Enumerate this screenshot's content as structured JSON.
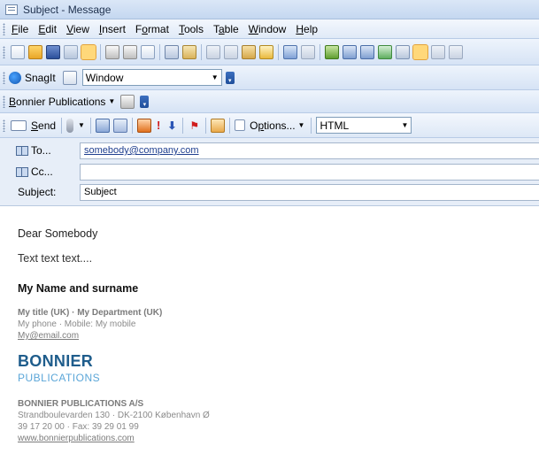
{
  "window": {
    "title": "Subject - Message"
  },
  "menu": [
    {
      "label": "File",
      "accel": "F",
      "rest": "ile"
    },
    {
      "label": "Edit",
      "accel": "E",
      "rest": "dit"
    },
    {
      "label": "View",
      "accel": "V",
      "rest": "iew"
    },
    {
      "label": "Insert",
      "accel": "I",
      "rest": "nsert"
    },
    {
      "label": "Format",
      "pre": "F",
      "accel": "o",
      "rest": "rmat"
    },
    {
      "label": "Tools",
      "accel": "T",
      "rest": "ools"
    },
    {
      "label": "Table",
      "pre": "T",
      "accel": "a",
      "rest": "ble"
    },
    {
      "label": "Window",
      "accel": "W",
      "rest": "indow"
    },
    {
      "label": "Help",
      "accel": "H",
      "rest": "elp"
    }
  ],
  "snagit": {
    "label": "SnagIt",
    "combo_value": "Window"
  },
  "bonnier_toolbar": {
    "label_accel": "B",
    "label_rest": "onnier Publications"
  },
  "send_toolbar": {
    "send_accel": "S",
    "send_rest": "end",
    "options_pre": "O",
    "options_accel": "p",
    "options_rest": "tions...",
    "format_value": "HTML"
  },
  "header": {
    "to_label": "To...",
    "to_value": "somebody@company.com",
    "cc_label": "Cc...",
    "cc_value": "",
    "subject_label": "Subject:",
    "subject_value": "Subject"
  },
  "message": {
    "greeting": "Dear Somebody",
    "text": "Text text text....",
    "name": "My Name and surname",
    "title_line": "My title (UK) · My Department (UK)",
    "phone_line": "My phone · Mobile: My mobile",
    "email": "My@email.com",
    "brand": "BONNIER",
    "brand_sub": "PUBLICATIONS",
    "company": "BONNIER PUBLICATIONS A/S",
    "address": "Strandboulevarden 130 · DK-2100 København Ø",
    "phone_fax": "39 17 20 00 · Fax: 39 29 01 99",
    "website": "www.bonnierpublications.com"
  }
}
